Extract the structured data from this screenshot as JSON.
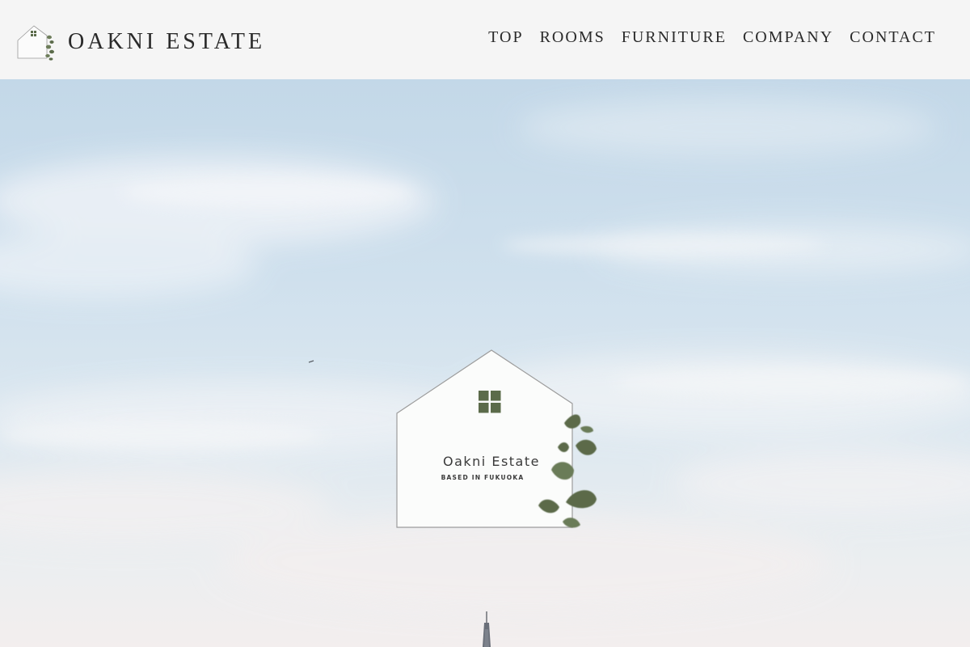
{
  "brand": {
    "name": "OAKNI ESTATE"
  },
  "nav": {
    "items": [
      {
        "label": "TOP"
      },
      {
        "label": "ROOMS"
      },
      {
        "label": "FURNITURE"
      },
      {
        "label": "COMPANY"
      },
      {
        "label": "CONTACT"
      }
    ]
  },
  "hero": {
    "logo_title": "Oakni Estate",
    "logo_subtitle": "BASED IN FUKUOKA"
  },
  "colors": {
    "leaf_green": "#5b6b4a",
    "header_bg": "#f5f5f5",
    "text": "#2a2a2a"
  },
  "icons": {
    "brand_mark": "house-with-leaves-icon",
    "window": "window-icon"
  }
}
